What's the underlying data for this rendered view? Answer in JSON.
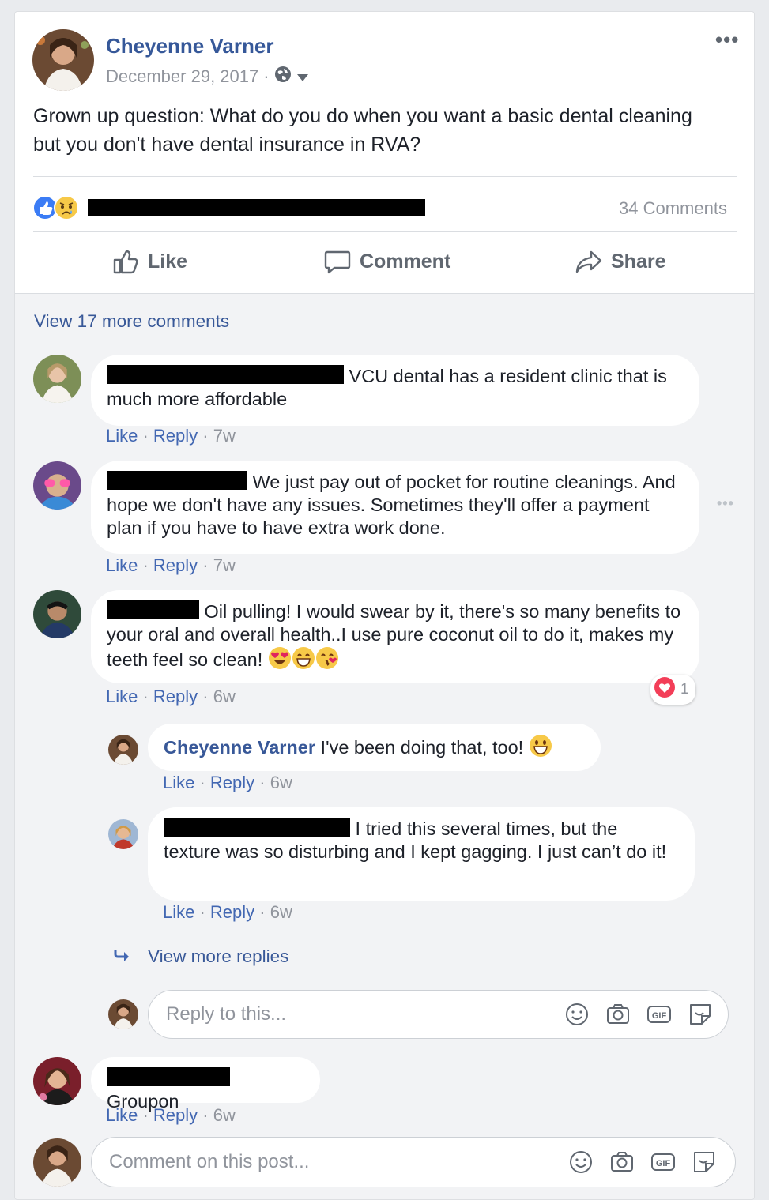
{
  "post": {
    "author": "Cheyenne Varner",
    "date": "December 29, 2017",
    "separator": "·",
    "privacy_icon": "globe-icon",
    "text": "Grown up question: What do you do when you want a basic dental cleaning but you don't have dental insurance in RVA?",
    "reactions_icons": [
      "like-reaction-icon",
      "sad-reaction-icon"
    ],
    "comments_count": "34 Comments"
  },
  "actions": {
    "like": "Like",
    "comment": "Comment",
    "share": "Share"
  },
  "comments_section": {
    "view_more": "View 17 more comments",
    "comments": [
      {
        "text": "VCU dental has a resident clinic that is much more affordable",
        "like": "Like",
        "reply": "Reply",
        "time": "7w"
      },
      {
        "text": "We just pay out of pocket for routine cleanings. And hope we don't have any issues. Sometimes they'll offer a payment plan if you have to have extra work done.",
        "like": "Like",
        "reply": "Reply",
        "time": "7w"
      },
      {
        "text": "Oil pulling! I would swear by it, there's so many benefits to your oral and overall health..I use pure coconut oil to do it, makes my teeth feel so clean!",
        "like": "Like",
        "reply": "Reply",
        "time": "6w",
        "reaction_count": "1"
      },
      {
        "text": "Groupon",
        "like": "Like",
        "reply": "Reply",
        "time": "6w"
      }
    ],
    "replies": [
      {
        "author": "Cheyenne Varner",
        "text": "I've been doing that, too!",
        "like": "Like",
        "reply": "Reply",
        "time": "6w"
      },
      {
        "text": "I tried this several times, but the texture was so disturbing and I kept gagging. I just can’t do it!",
        "like": "Like",
        "reply": "Reply",
        "time": "6w"
      }
    ],
    "view_more_replies": "View more replies",
    "reply_placeholder": "Reply to this...",
    "comment_placeholder": "Comment on this post..."
  },
  "colors": {
    "link": "#365899",
    "meta": "#90949c",
    "background": "#e9ebee",
    "comments_bg": "#f2f3f5"
  }
}
